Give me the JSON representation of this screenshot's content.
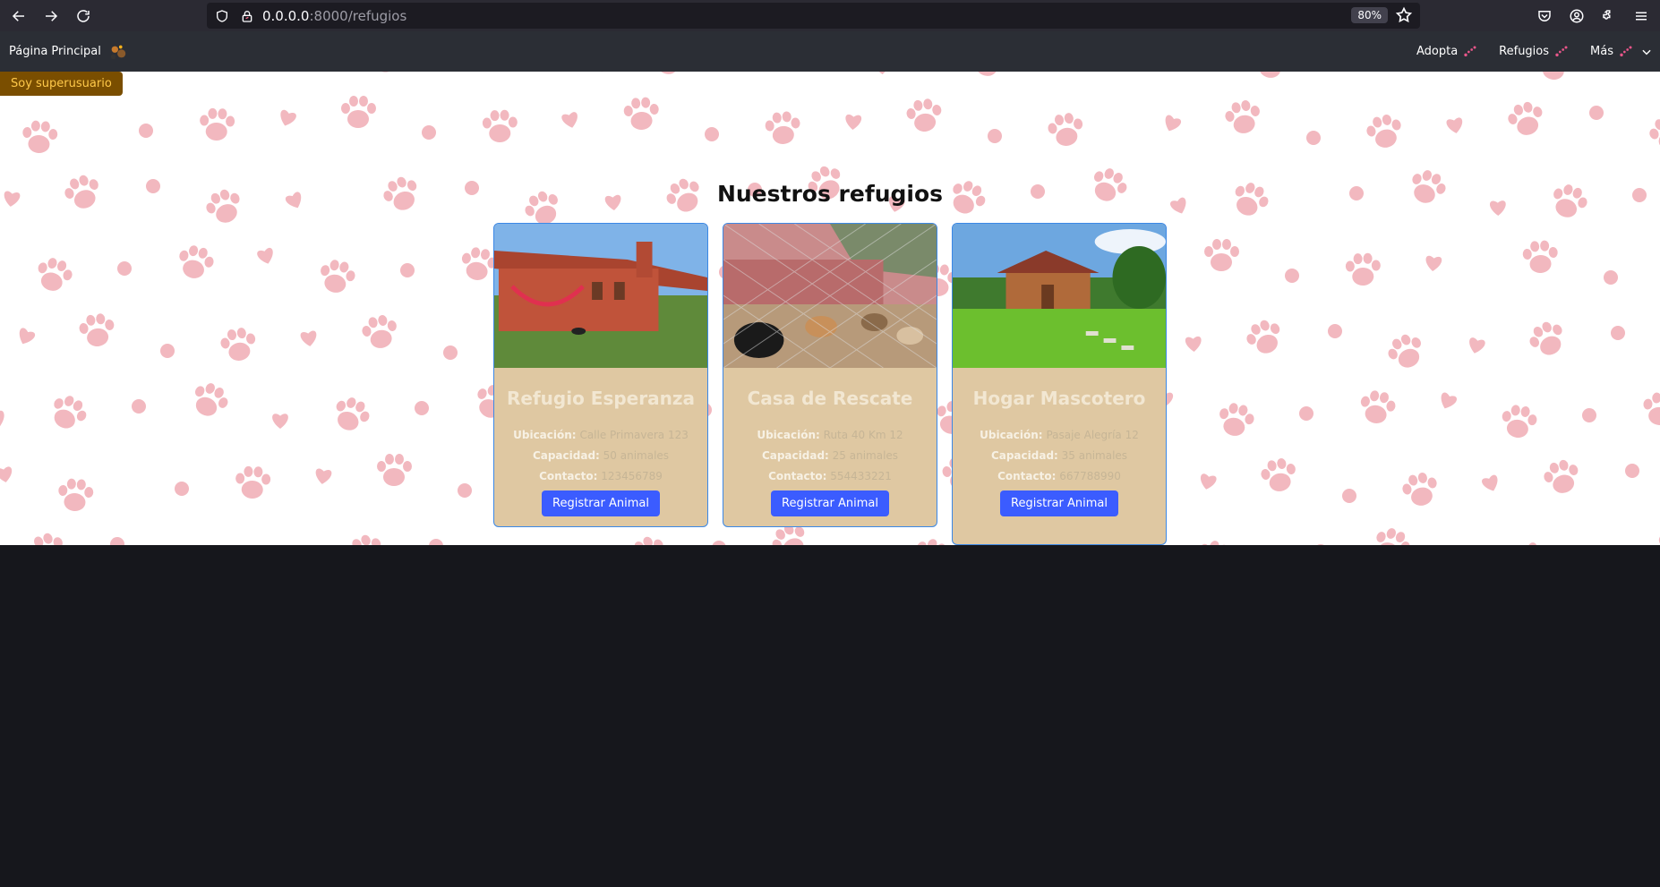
{
  "browser": {
    "url_host": "0.0.0.0",
    "url_path": ":8000/refugios",
    "zoom": "80%"
  },
  "site_nav": {
    "brand": "Página Principal",
    "links": [
      {
        "label": "Adopta"
      },
      {
        "label": "Refugios"
      },
      {
        "label": "Más"
      }
    ]
  },
  "badge": "Soy superusuario",
  "page_title": "Nuestros refugios",
  "labels": {
    "location": "Ubicación:",
    "capacity": "Capacidad:",
    "contact": "Contacto:"
  },
  "shelters": [
    {
      "name": "Refugio Esperanza",
      "location": "Calle Primavera 123",
      "capacity": "50 animales",
      "contact": "123456789",
      "button": "Registrar Animal"
    },
    {
      "name": "Casa de Rescate",
      "location": "Ruta 40 Km 12",
      "capacity": "25 animales",
      "contact": "554433221",
      "button": "Registrar Animal"
    },
    {
      "name": "Hogar Mascotero",
      "location": "Pasaje Alegría 12",
      "capacity": "35 animales",
      "contact": "667788990",
      "button": "Registrar Animal"
    }
  ],
  "colors": {
    "paw": "#f2b8bf",
    "card_bg": "#dfc8a2",
    "button": "#3b5cff",
    "badge_bg": "#7a4e00"
  }
}
